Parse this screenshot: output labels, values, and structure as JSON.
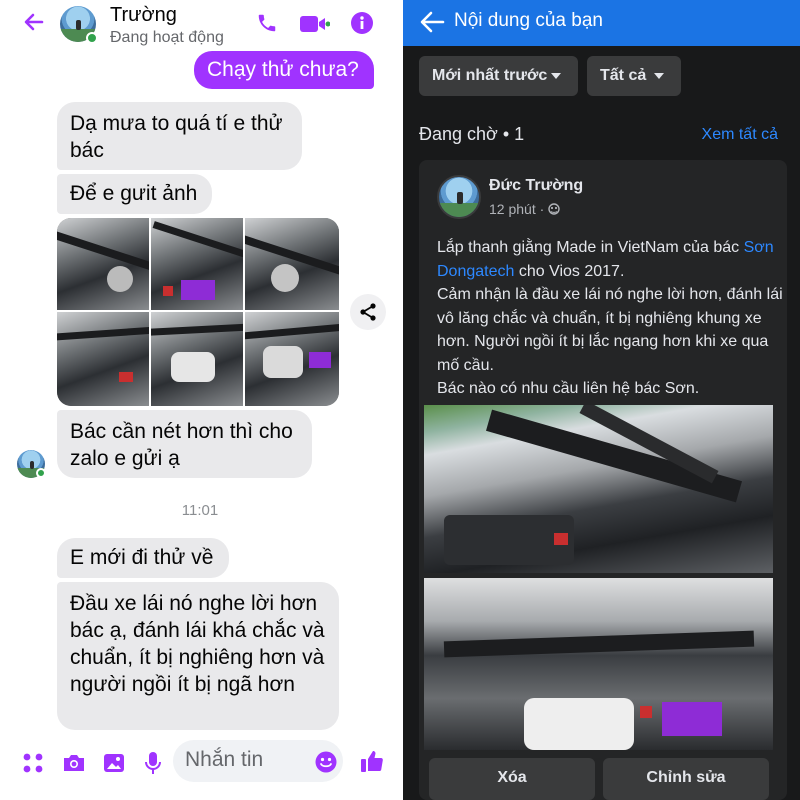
{
  "messenger": {
    "contact_name": "Trường",
    "contact_status": "Đang hoạt động",
    "icons": {
      "back": "back-arrow-icon",
      "call": "phone-icon",
      "video": "video-call-icon",
      "info": "info-icon"
    },
    "accent": "#a033ff",
    "messages": [
      {
        "dir": "out",
        "text": "Chạy thử chưa?"
      },
      {
        "dir": "in",
        "text": "Dạ mưa to quá tí e thử bác"
      },
      {
        "dir": "in",
        "text": "Để e gưit ảnh"
      },
      {
        "dir": "in",
        "type": "photos",
        "count": 6
      },
      {
        "dir": "in",
        "text": "Bác cần nét hơn thì cho zalo e gửi ạ"
      },
      {
        "dir": "in",
        "text": "E mới đi thử về"
      },
      {
        "dir": "in",
        "text": "Đầu xe lái nó nghe lời hơn bác ạ, đánh lái khá chắc và chuẩn, ít bị nghiêng hơn và người ngồi ít bị ngã hơn"
      }
    ],
    "time_separator": "11:01",
    "composer": {
      "placeholder": "Nhắn tin",
      "icons": [
        "menu-dots-icon",
        "camera-icon",
        "gallery-icon",
        "microphone-icon",
        "emoji-icon",
        "like-icon"
      ]
    }
  },
  "facebook": {
    "title": "Nội dung của bạn",
    "filters": [
      "Mới nhất trước",
      "Tất cả"
    ],
    "pending_label": "Đang chờ • 1",
    "see_all": "Xem tất cả",
    "post": {
      "author": "Đức Trường",
      "time": "12 phút · ",
      "privacy_icon": "friends-icon",
      "text_before_link": "Lắp thanh giằng Made in VietNam của bác ",
      "link": "Sơn Dongatech",
      "text_after_link": " cho Vios 2017.",
      "lines": [
        "Cảm nhận là đầu xe lái nó nghe lời hơn, đánh lái vô lăng chắc và chuẩn, ít bị nghiêng khung xe hơn. Người ngồi ít bị lắc ngang hơn khi xe qua mố cầu.",
        "Bác nào có nhu cầu liên hệ bác Sơn."
      ],
      "image_count": 2
    },
    "actions": [
      "Xóa",
      "Chỉnh sửa"
    ],
    "accent": "#1b74e4"
  }
}
